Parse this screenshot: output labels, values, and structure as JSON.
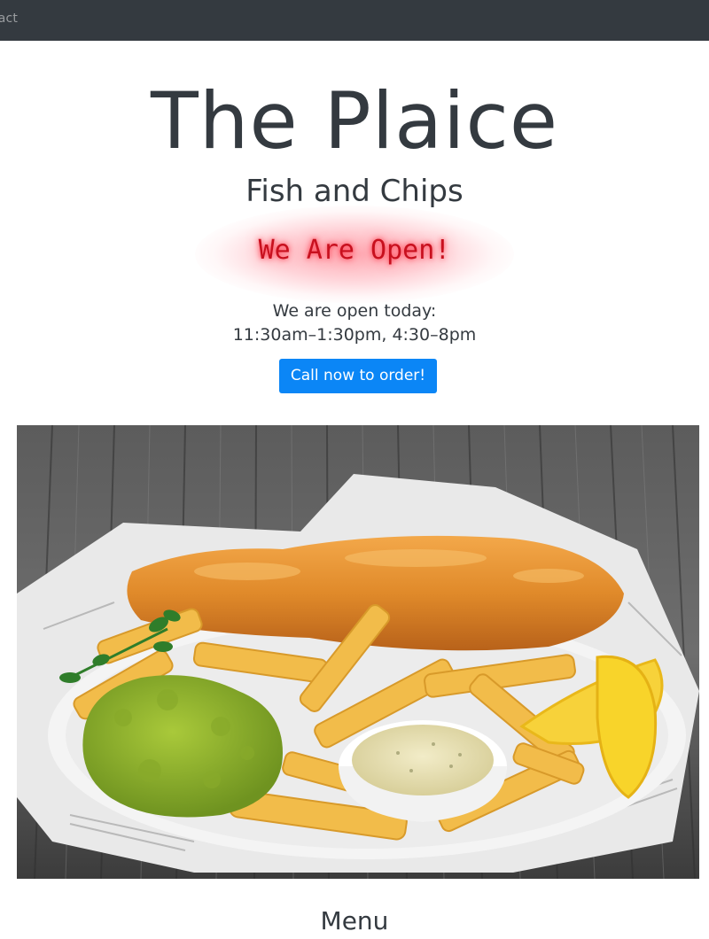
{
  "nav": {
    "contact_label": "tact"
  },
  "header": {
    "title": "The Plaice",
    "subtitle": "Fish and Chips",
    "status_sign": "We Are Open!"
  },
  "hours": {
    "line1": "We are open today:",
    "line2": "11:30am–1:30pm, 4:30–8pm"
  },
  "cta": {
    "call_label": "Call now to order!"
  },
  "sections": {
    "menu_heading": "Menu"
  },
  "colors": {
    "navbar": "#343a40",
    "text": "#343a40",
    "button": "#0b86f6",
    "open_sign": "#c8101e"
  }
}
